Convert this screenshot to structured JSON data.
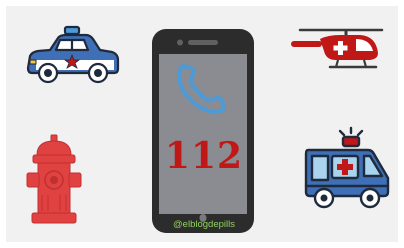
{
  "phone": {
    "number": "112",
    "credit": "@elblogdepills"
  },
  "icons": {
    "police_car": "police-car-icon",
    "helicopter": "helicopter-icon",
    "fire_hydrant": "fire-hydrant-icon",
    "ambulance": "ambulance-icon",
    "phone_handset": "phone-handset-icon",
    "mobile_phone": "mobile-phone-icon"
  },
  "colors": {
    "background": "#f1f1f1",
    "emergency_red": "#c01717",
    "icon_outline": "#1f2a3c",
    "vehicle_blue": "#3f6fb6",
    "handset_blue": "#4c9ad8",
    "credit_green": "#8fd35a"
  }
}
